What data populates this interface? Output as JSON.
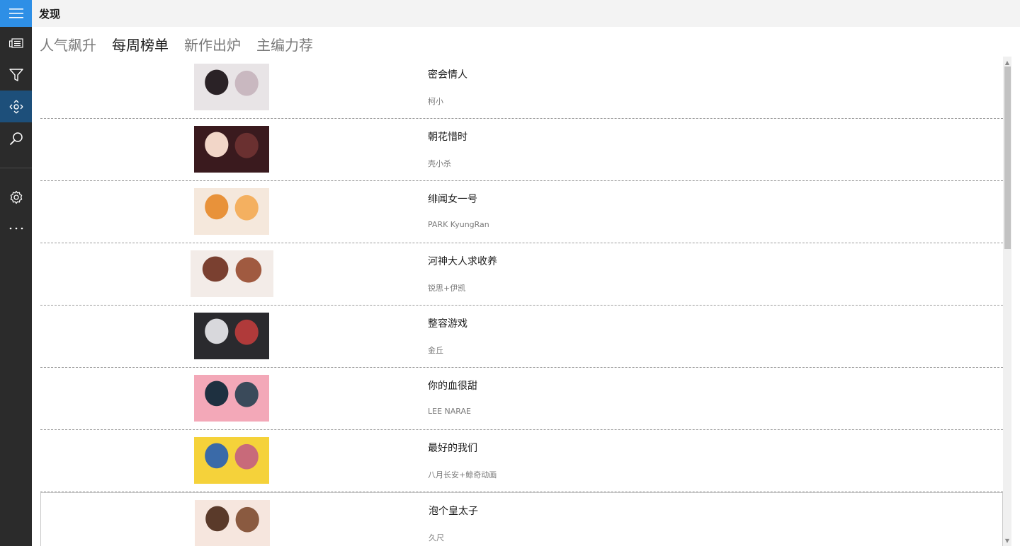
{
  "header": {
    "title": "发现"
  },
  "nav": {
    "items": [
      {
        "icon": "hamburger-menu-icon"
      },
      {
        "icon": "news-icon"
      },
      {
        "icon": "filter-icon"
      },
      {
        "icon": "discover-icon",
        "selected": true
      },
      {
        "icon": "search-icon"
      },
      {
        "icon": "settings-icon"
      },
      {
        "icon": "more-icon"
      }
    ],
    "accent": "#2e8fe6",
    "selected_bg": "#1d4f7a"
  },
  "tabs": [
    {
      "label": "人气飙升",
      "active": false
    },
    {
      "label": "每周榜单",
      "active": true
    },
    {
      "label": "新作出炉",
      "active": false
    },
    {
      "label": "主编力荐",
      "active": false
    }
  ],
  "comics": [
    {
      "title": "密会情人",
      "author": "柯小",
      "palette": [
        "#e8e4e6",
        "#2a2226",
        "#8a5a7a",
        "#c9b8c0"
      ]
    },
    {
      "title": "朝花惜时",
      "author": "壳小杀",
      "palette": [
        "#3a1a1e",
        "#f2d6c8",
        "#b02a2a",
        "#6a3030"
      ]
    },
    {
      "title": "绯闻女一号",
      "author": "PARK KyungRan",
      "palette": [
        "#f5e8dc",
        "#e8923a",
        "#3a4a5a",
        "#f4b060"
      ]
    },
    {
      "title": "河神大人求收养",
      "author": "锐思+伊凯",
      "palette": [
        "#f3ece8",
        "#7a4030",
        "#d8c8c0",
        "#a05a40"
      ]
    },
    {
      "title": "整容游戏",
      "author": "金丘",
      "palette": [
        "#2a2a2e",
        "#d8d8dc",
        "#5a5a60",
        "#b03a3a"
      ]
    },
    {
      "title": "你的血很甜",
      "author": "LEE NARAE",
      "palette": [
        "#f3a8b8",
        "#1e3040",
        "#f6d0d8",
        "#3a4a5a"
      ]
    },
    {
      "title": "最好的我们",
      "author": "八月长安+鲸奇动画",
      "palette": [
        "#f5d23a",
        "#3a6aa8",
        "#f4e8c0",
        "#c86a7a"
      ]
    },
    {
      "title": "泡个皇太子",
      "author": "久尺",
      "palette": [
        "#f6e6de",
        "#5a3a2a",
        "#d8a890",
        "#8a5a40"
      ]
    }
  ]
}
